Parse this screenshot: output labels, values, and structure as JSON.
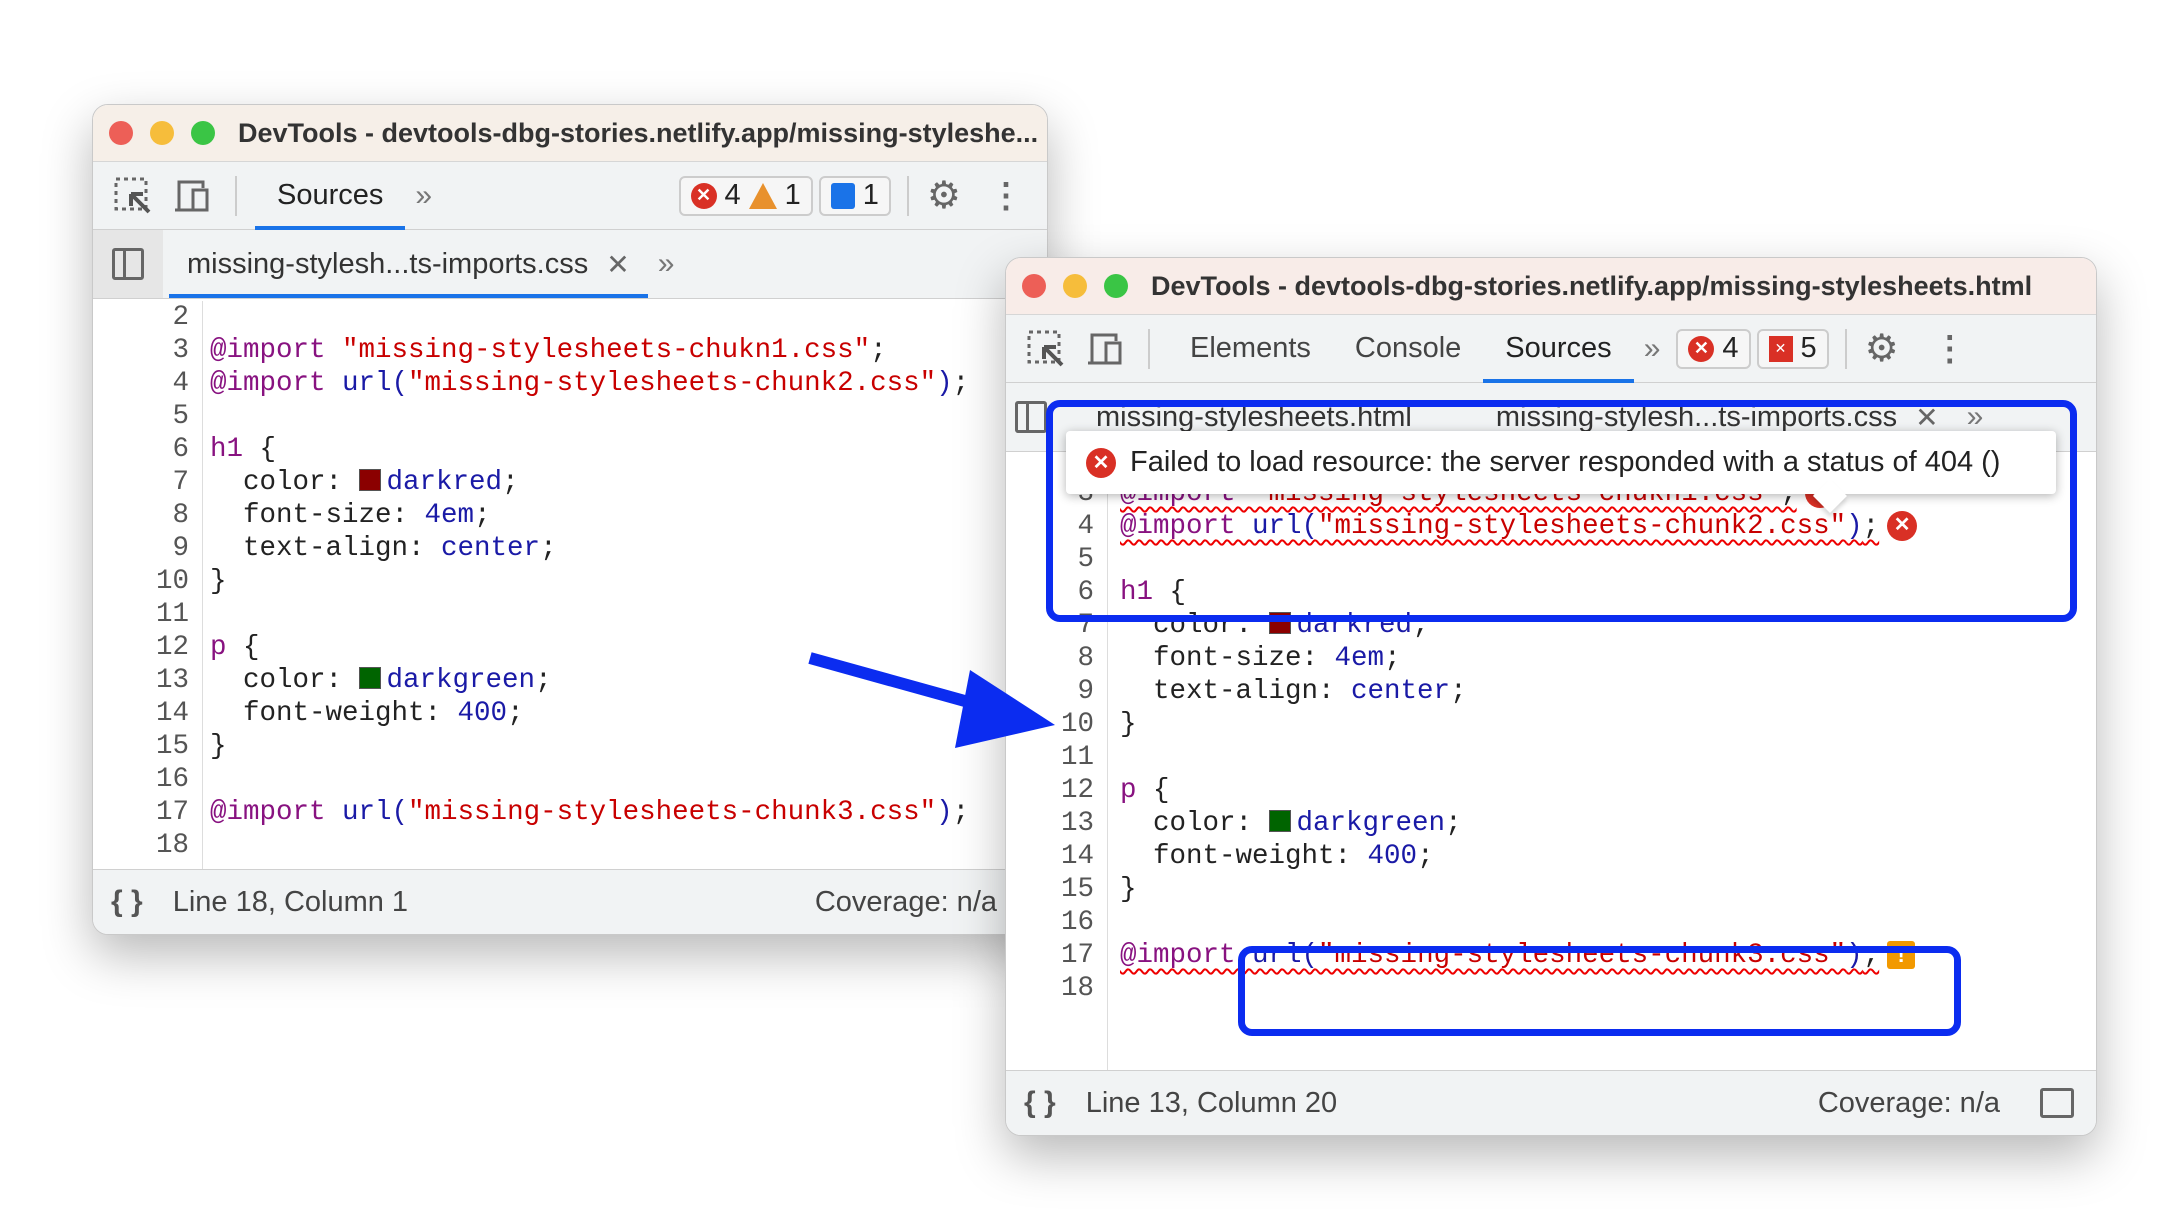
{
  "colors": {
    "accent": "#1a73e8",
    "highlight": "#0b2cf0",
    "error": "#d93025",
    "warning": "#f29900"
  },
  "left_window": {
    "title": "DevTools - devtools-dbg-stories.netlify.app/missing-styleshe...",
    "tabs": [
      {
        "label": "Sources",
        "active": true
      }
    ],
    "badges": {
      "errors": "4",
      "warnings": "1",
      "messages": "1"
    },
    "file_tabs": [
      {
        "label": "missing-stylesh...ts-imports.css",
        "active": true
      }
    ],
    "status": {
      "position": "Line 18, Column 1",
      "coverage": "Coverage: n/a"
    }
  },
  "right_window": {
    "title": "DevTools - devtools-dbg-stories.netlify.app/missing-stylesheets.html",
    "tabs": [
      {
        "label": "Elements"
      },
      {
        "label": "Console"
      },
      {
        "label": "Sources",
        "active": true
      }
    ],
    "badges": {
      "errors": "4",
      "issues": "5"
    },
    "file_tabs": [
      {
        "label": "missing-stylesheets.html"
      },
      {
        "label": "missing-stylesh...ts-imports.css",
        "active": true
      }
    ],
    "tooltip": "Failed to load resource: the server responded with a status of 404 ()",
    "status": {
      "position": "Line 13, Column 20",
      "coverage": "Coverage: n/a"
    }
  },
  "code_lines": [
    {
      "n": "2",
      "t": []
    },
    {
      "n": "3",
      "t": [
        [
          "k",
          "@import "
        ],
        [
          "s",
          "\"missing-stylesheets-chukn1.css\""
        ],
        [
          "p",
          ";"
        ]
      ],
      "mark": "error"
    },
    {
      "n": "4",
      "t": [
        [
          "k",
          "@import "
        ],
        [
          "u",
          "url("
        ],
        [
          "s",
          "\"missing-stylesheets-chunk2.css\""
        ],
        [
          "u",
          ")"
        ],
        [
          "p",
          ";"
        ]
      ],
      "mark": "error"
    },
    {
      "n": "5",
      "t": []
    },
    {
      "n": "6",
      "t": [
        [
          "k",
          "h1"
        ],
        [
          "p",
          " {"
        ]
      ]
    },
    {
      "n": "7",
      "t": [
        [
          "p",
          "  color: "
        ],
        [
          "sw",
          "#8b0000"
        ],
        [
          "v",
          "darkred"
        ],
        [
          "p",
          ";"
        ]
      ]
    },
    {
      "n": "8",
      "t": [
        [
          "p",
          "  font-size: "
        ],
        [
          "v",
          "4em"
        ],
        [
          "p",
          ";"
        ]
      ]
    },
    {
      "n": "9",
      "t": [
        [
          "p",
          "  text-align: "
        ],
        [
          "v",
          "center"
        ],
        [
          "p",
          ";"
        ]
      ]
    },
    {
      "n": "10",
      "t": [
        [
          "p",
          "}"
        ]
      ]
    },
    {
      "n": "11",
      "t": []
    },
    {
      "n": "12",
      "t": [
        [
          "k",
          "p"
        ],
        [
          "p",
          " {"
        ]
      ]
    },
    {
      "n": "13",
      "t": [
        [
          "p",
          "  color: "
        ],
        [
          "sw",
          "#006400"
        ],
        [
          "v",
          "darkgreen"
        ],
        [
          "p",
          ";"
        ]
      ]
    },
    {
      "n": "14",
      "t": [
        [
          "p",
          "  font-weight: "
        ],
        [
          "v",
          "400"
        ],
        [
          "p",
          ";"
        ]
      ]
    },
    {
      "n": "15",
      "t": [
        [
          "p",
          "}"
        ]
      ]
    },
    {
      "n": "16",
      "t": []
    },
    {
      "n": "17",
      "t": [
        [
          "k",
          "@import "
        ],
        [
          "u",
          "url("
        ],
        [
          "s",
          "\"missing-stylesheets-chunk3.css\""
        ],
        [
          "u",
          ")"
        ],
        [
          "p",
          ";"
        ]
      ],
      "mark": "warning"
    },
    {
      "n": "18",
      "t": []
    }
  ]
}
